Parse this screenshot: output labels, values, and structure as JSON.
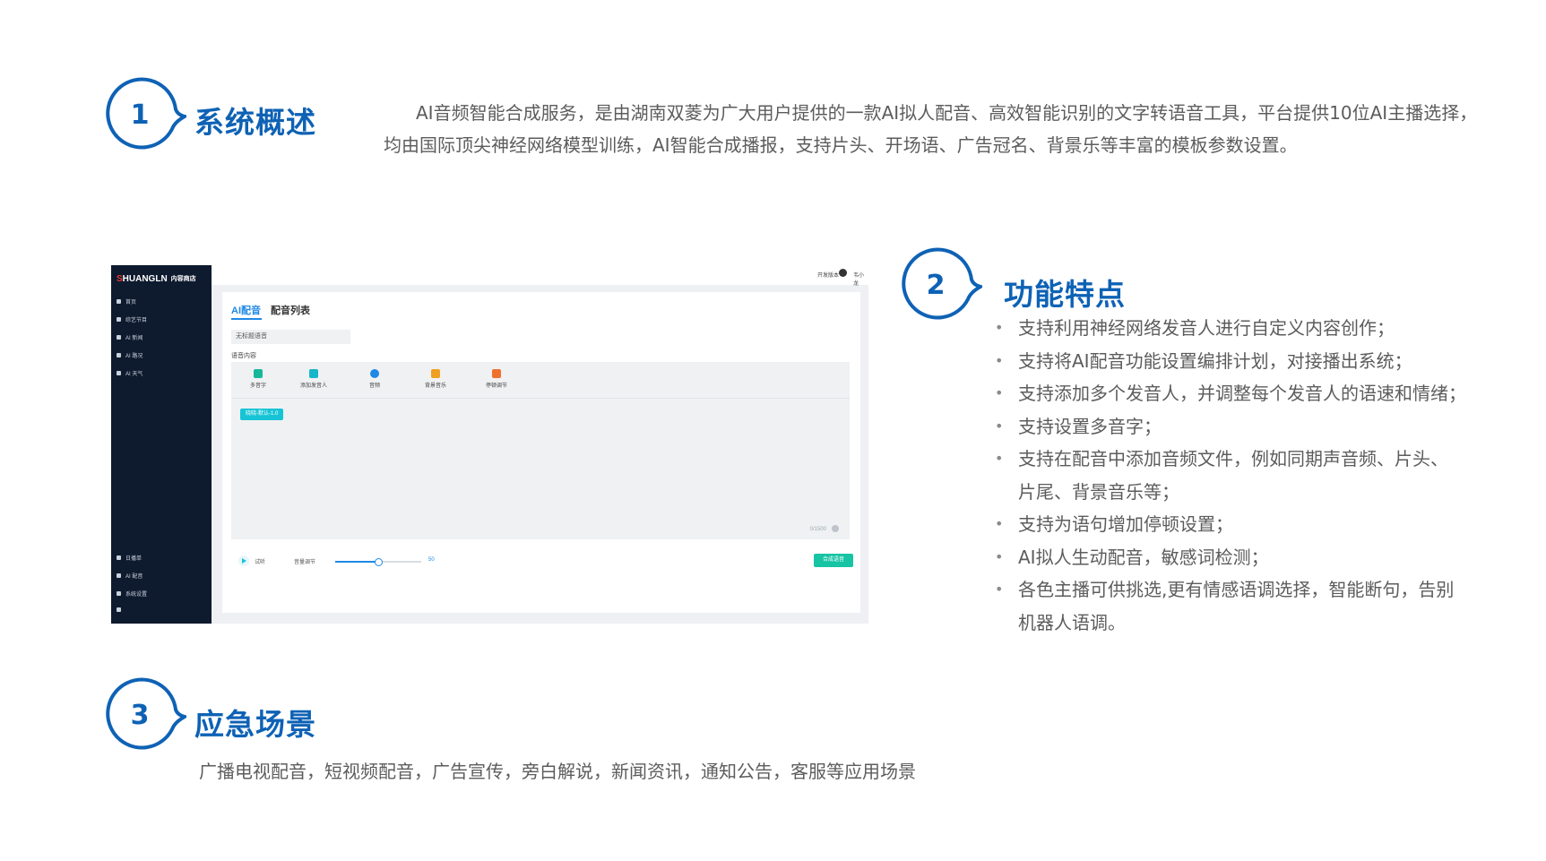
{
  "section1": {
    "number": "1",
    "title": "系统概述",
    "line1": "AI音频智能合成服务，是由湖南双菱为广大用户提供的一款AI拟人配音、高效智能识别的文字转语音工具，平台提供10位AI主播选择，",
    "line2": "均由国际顶尖神经网络模型训练，AI智能合成播报，支持片头、开场语、广告冠名、背景乐等丰富的模板参数设置。"
  },
  "section2": {
    "number": "2",
    "title": "功能特点",
    "bullets": [
      {
        "l1": "支持利用神经网络发音人进行自定义内容创作；"
      },
      {
        "l1": "支持将AI配音功能设置编排计划，对接播出系统；"
      },
      {
        "l1": "支持添加多个发音人，并调整每个发音人的语速和情绪；"
      },
      {
        "l1": "支持设置多音字；"
      },
      {
        "l1": "支持在配音中添加音频文件，例如同期声音频、片头、",
        "l2": "片尾、背景音乐等；"
      },
      {
        "l1": "支持为语句增加停顿设置；"
      },
      {
        "l1": "AI拟人生动配音，敏感词检测；"
      },
      {
        "l1": "各色主播可供挑选,更有情感语调选择，智能断句，告别",
        "l2": "机器人语调。"
      }
    ]
  },
  "section3": {
    "number": "3",
    "title": "应急场景",
    "text": "广播电视配音，短视频配音，广告宣传，旁白解说，新闻资讯，通知公告，客服等应用场景"
  },
  "app": {
    "logo_a": "S",
    "logo_b": "HUANGLN",
    "logo_sub": "内容商店",
    "nav": [
      "首页",
      "综艺节目",
      "AI 新闻",
      "AI 路况",
      "AI 天气"
    ],
    "nav_bottom": [
      "日播单",
      "AI 配音",
      "系统设置"
    ],
    "top_dev": "开发版本",
    "top_user": "韦小龙",
    "tab_ai": "AI配音",
    "tab_list": "配音列表",
    "title_value": "无标题语音",
    "content_label": "语音内容",
    "tools": [
      {
        "label": "多音字",
        "icon": "polyphone-icon",
        "color": "#17b89a"
      },
      {
        "label": "添加发音人",
        "icon": "add-speaker-icon",
        "color": "#17b5c9"
      },
      {
        "label": "音频",
        "icon": "audio-icon",
        "color": "#1e88e5"
      },
      {
        "label": "背景音乐",
        "icon": "music-icon",
        "color": "#f0a020"
      },
      {
        "label": "停顿调节",
        "icon": "pause-icon",
        "color": "#f07030"
      }
    ],
    "tag": "晓晓-默认-1.0",
    "count": "0/1500",
    "listen": "试听",
    "volume_label": "音量调节",
    "volume_value": "50",
    "volume_fraction": 0.5,
    "synth_button": "合成语音"
  },
  "colors": {
    "accent": "#0e62b5",
    "sidebar": "#0e1a2e",
    "teal": "#17c4d6"
  }
}
